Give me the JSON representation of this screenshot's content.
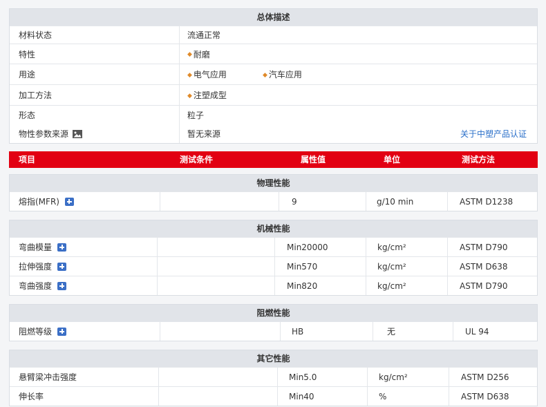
{
  "overview": {
    "title": "总体描述",
    "rows": [
      {
        "label": "材料状态",
        "values": [
          "流通正常"
        ],
        "bullets": false
      },
      {
        "label": "特性",
        "values": [
          "耐磨"
        ],
        "bullets": true
      },
      {
        "label": "用途",
        "values": [
          "电气应用",
          "汽车应用"
        ],
        "bullets": true
      },
      {
        "label": "加工方法",
        "values": [
          "注塑成型"
        ],
        "bullets": true
      },
      {
        "label": "形态",
        "values": [
          "粒子"
        ],
        "bullets": false
      },
      {
        "label": "物性参数来源",
        "values": [
          "暂无来源"
        ],
        "bullets": false,
        "icon": "image-icon",
        "link": "关于中塑产品认证"
      }
    ]
  },
  "columns": {
    "item": "项目",
    "condition": "测试条件",
    "value": "属性值",
    "unit": "单位",
    "method": "测试方法"
  },
  "sections": [
    {
      "title": "物理性能",
      "rows": [
        {
          "name": "熔指(MFR)",
          "plus": true,
          "condition": "",
          "value": "9",
          "unit": "g/10 min",
          "method": "ASTM D1238"
        }
      ]
    },
    {
      "title": "机械性能",
      "rows": [
        {
          "name": "弯曲模量",
          "plus": true,
          "condition": "",
          "value": "Min20000",
          "unit": "kg/cm²",
          "method": "ASTM D790"
        },
        {
          "name": "拉伸强度",
          "plus": true,
          "condition": "",
          "value": "Min570",
          "unit": "kg/cm²",
          "method": "ASTM D638"
        },
        {
          "name": "弯曲强度",
          "plus": true,
          "condition": "",
          "value": "Min820",
          "unit": "kg/cm²",
          "method": "ASTM D790"
        }
      ]
    },
    {
      "title": "阻燃性能",
      "rows": [
        {
          "name": "阻燃等级",
          "plus": true,
          "condition": "",
          "value": "HB",
          "unit": "无",
          "method": "UL 94"
        }
      ]
    },
    {
      "title": "其它性能",
      "rows": [
        {
          "name": "悬臂梁冲击强度",
          "plus": false,
          "condition": "",
          "value": "Min5.0",
          "unit": "kg/cm²",
          "method": "ASTM D256"
        },
        {
          "name": "伸长率",
          "plus": false,
          "condition": "",
          "value": "Min40",
          "unit": "%",
          "method": "ASTM D638"
        }
      ]
    }
  ]
}
